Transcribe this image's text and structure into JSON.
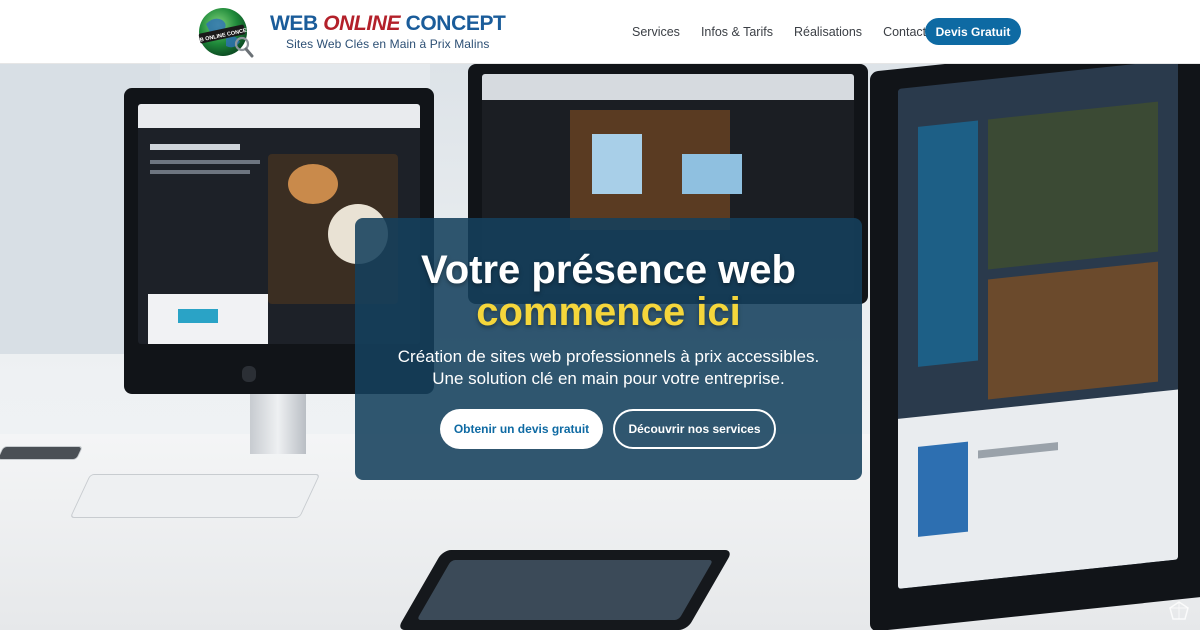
{
  "brand": {
    "word1": "WEB",
    "word2": "ONLINE",
    "word3": "CONCEPT",
    "tagline": "Sites Web Clés en Main à Prix Malins",
    "globe_text": "WEB ONLINE CONCEPT"
  },
  "nav": {
    "items": [
      "Services",
      "Infos & Tarifs",
      "Réalisations",
      "Contact"
    ],
    "cta": "Devis Gratuit"
  },
  "hero": {
    "title_line1": "Votre présence web",
    "title_line2": "commence ici",
    "subtitle_line1": "Création de sites web professionnels à prix accessibles.",
    "subtitle_line2": "Une solution clé en main pour votre entreprise.",
    "primary_button": "Obtenir un devis gratuit",
    "secondary_button": "Découvrir nos services"
  },
  "colors": {
    "brand_blue": "#1a5c9a",
    "brand_red": "#b3202a",
    "cta_blue": "#0e6aa3",
    "card_bg": "#14405c",
    "accent_yellow": "#f5d63b"
  },
  "icons": {
    "logo": "globe-magnifier-logo",
    "corner": "watermark-icon"
  }
}
